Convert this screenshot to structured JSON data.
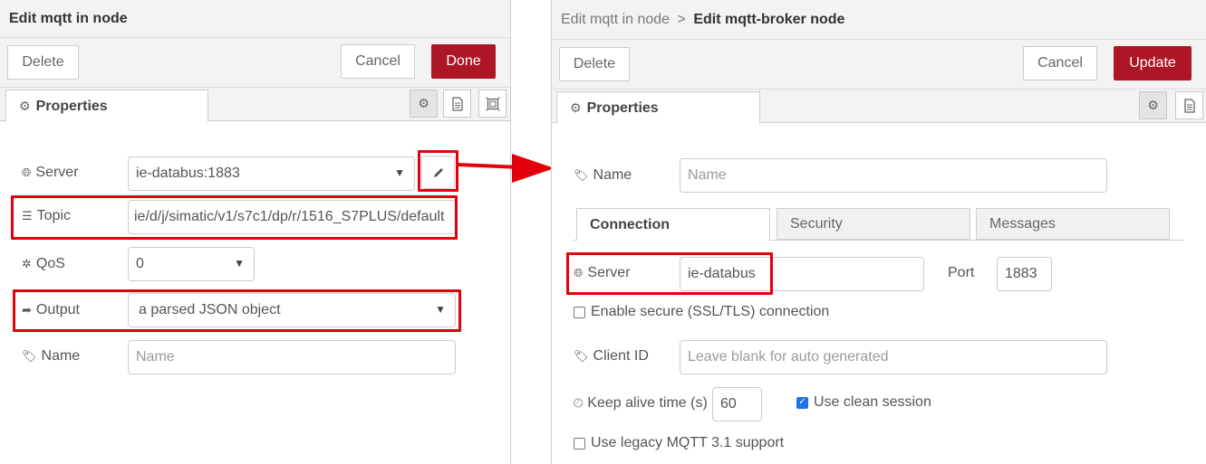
{
  "left": {
    "title": "Edit mqtt in node",
    "buttons": {
      "delete": "Delete",
      "cancel": "Cancel",
      "done": "Done"
    },
    "tab": {
      "label": "Properties"
    },
    "fields": {
      "server": {
        "label": "Server",
        "value": "ie-databus:1883"
      },
      "topic": {
        "label": "Topic",
        "value": "ie/d/j/simatic/v1/s7c1/dp/r/1516_S7PLUS/default"
      },
      "qos": {
        "label": "QoS",
        "value": "0"
      },
      "output": {
        "label": "Output",
        "value": "a parsed JSON object"
      },
      "name": {
        "label": "Name",
        "placeholder": "Name"
      }
    }
  },
  "right": {
    "breadcrumb": {
      "parent": "Edit mqtt in node",
      "separator": ">",
      "current": "Edit mqtt-broker node"
    },
    "buttons": {
      "delete": "Delete",
      "cancel": "Cancel",
      "update": "Update"
    },
    "tab": {
      "label": "Properties"
    },
    "name": {
      "label": "Name",
      "placeholder": "Name"
    },
    "subtabs": [
      "Connection",
      "Security",
      "Messages"
    ],
    "server": {
      "label": "Server",
      "value": "ie-databus"
    },
    "port": {
      "label": "Port",
      "value": "1883"
    },
    "tls": {
      "label": "Enable secure (SSL/TLS) connection",
      "checked": false
    },
    "client_id": {
      "label": "Client ID",
      "placeholder": "Leave blank for auto generated"
    },
    "keepalive": {
      "label": "Keep alive time (s)",
      "value": "60"
    },
    "clean_session": {
      "label": "Use clean session",
      "checked": true
    },
    "legacy": {
      "label": "Use legacy MQTT 3.1 support",
      "checked": false
    }
  },
  "colors": {
    "highlight": "#e3000b",
    "primary": "#ad1625",
    "checkbox": "#1a73e8"
  }
}
